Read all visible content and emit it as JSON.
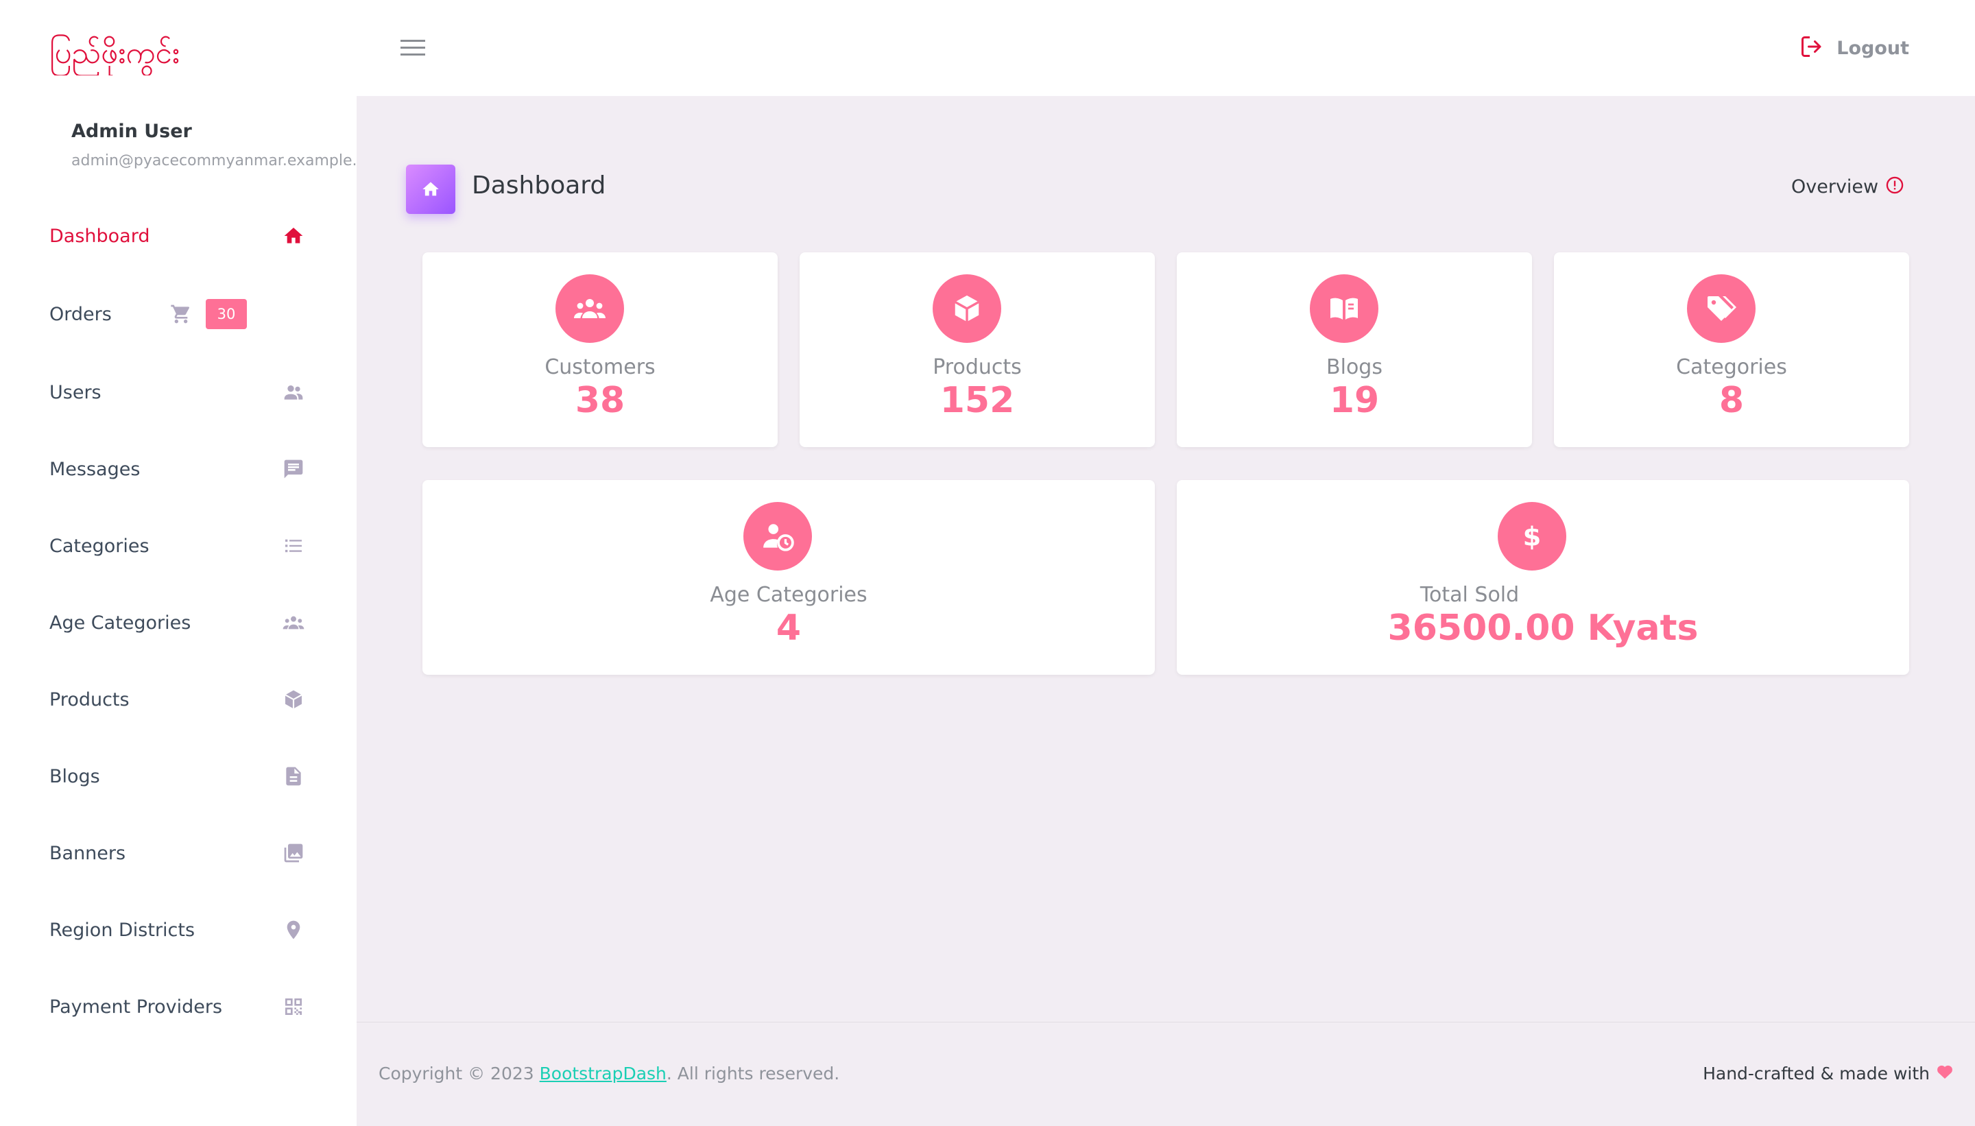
{
  "brand": {
    "logo_text": "ပြည်ဖိုးကွင်း"
  },
  "profile": {
    "name": "Admin User",
    "email": "admin@pyacecommyanmar.example.com"
  },
  "sidebar": {
    "items": [
      {
        "label": "Dashboard",
        "icon": "home-icon",
        "active": true
      },
      {
        "label": "Orders",
        "icon": "cart-icon",
        "badge": "30"
      },
      {
        "label": "Users",
        "icon": "users-icon"
      },
      {
        "label": "Messages",
        "icon": "message-icon"
      },
      {
        "label": "Categories",
        "icon": "list-icon"
      },
      {
        "label": "Age Categories",
        "icon": "group-icon"
      },
      {
        "label": "Products",
        "icon": "cube-icon"
      },
      {
        "label": "Blogs",
        "icon": "document-icon"
      },
      {
        "label": "Banners",
        "icon": "image-icon"
      },
      {
        "label": "Region Districts",
        "icon": "map-pin-icon"
      },
      {
        "label": "Payment Providers",
        "icon": "qr-code-icon"
      }
    ]
  },
  "topbar": {
    "menu_icon": "hamburger-icon",
    "logout_label": "Logout"
  },
  "page": {
    "title": "Dashboard",
    "overview_label": "Overview"
  },
  "stats": [
    {
      "label": "Customers",
      "value": "38",
      "icon": "users-icon"
    },
    {
      "label": "Products",
      "value": "152",
      "icon": "cube-icon"
    },
    {
      "label": "Blogs",
      "value": "19",
      "icon": "book-icon"
    },
    {
      "label": "Categories",
      "value": "8",
      "icon": "tag-icon"
    },
    {
      "label": "Age Categories",
      "value": "4",
      "icon": "user-clock-icon"
    },
    {
      "label": "Total Sold",
      "value": "36500.00 Kyats",
      "icon": "dollar-icon"
    }
  ],
  "footer": {
    "copyright_prefix": "Copyright © 2023 ",
    "link_text": "BootstrapDash",
    "copyright_suffix": ". All rights reserved.",
    "credit": "Hand-crafted & made with"
  },
  "colors": {
    "accent_pink": "#fe7096",
    "active_red": "#e0103c",
    "page_bg": "#f2edf3",
    "footer_link": "#1bcfb4",
    "header_icon_gradient_start": "#da8cff",
    "header_icon_gradient_end": "#9a55ff"
  }
}
